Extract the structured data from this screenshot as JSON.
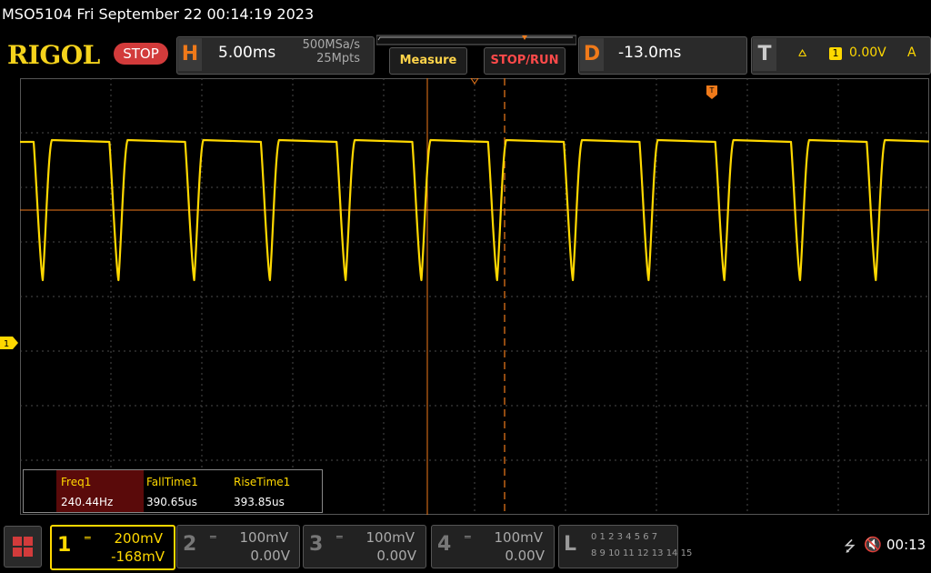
{
  "window": {
    "title": "MSO5104  Fri September 22 00:14:19 2023"
  },
  "brand": {
    "logo": "RIGOL",
    "run_state": "STOP"
  },
  "horizontal": {
    "letter": "H",
    "timebase": "5.00ms",
    "sample_rate": "500MSa/s",
    "memory_depth": "25Mpts"
  },
  "buttons": {
    "measure": "Measure",
    "stop_run": "STOP/RUN"
  },
  "delay": {
    "letter": "D",
    "value": "-13.0ms"
  },
  "trigger": {
    "letter": "T",
    "slope_icon": "rising-edge-icon",
    "source": "1",
    "level": "0.00V",
    "mode": "A"
  },
  "channel_marker": "1",
  "measurements": [
    {
      "label": "Freq1",
      "value": "240.44Hz"
    },
    {
      "label": "FallTime1",
      "value": "390.65us"
    },
    {
      "label": "RiseTime1",
      "value": "393.85us"
    }
  ],
  "channels": [
    {
      "number": "1",
      "scale": "200mV",
      "offset": "-168mV",
      "active": true
    },
    {
      "number": "2",
      "scale": "100mV",
      "offset": "0.00V",
      "active": false
    },
    {
      "number": "3",
      "scale": "100mV",
      "offset": "0.00V",
      "active": false
    },
    {
      "number": "4",
      "scale": "100mV",
      "offset": "0.00V",
      "active": false
    }
  ],
  "logic": {
    "letter": "L",
    "row1": "0 1 2 3  4 5 6 7",
    "row2": "8 9 10 11 12 13 14 15"
  },
  "status": {
    "time": "00:13",
    "usb_icon": "usb-icon",
    "speaker_icon": "speaker-muted-icon"
  },
  "colors": {
    "ch1": "#ffd800",
    "accent": "#f07a1a",
    "stop": "#d23b3b"
  }
}
